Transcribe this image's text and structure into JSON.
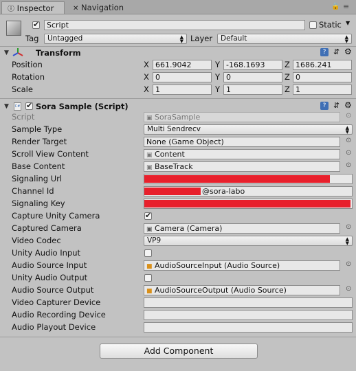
{
  "tabs": [
    {
      "label": "Inspector",
      "active": true
    },
    {
      "label": "Navigation",
      "active": false
    }
  ],
  "object": {
    "name": "Script",
    "static_label": "Static",
    "tag_label": "Tag",
    "tag_value": "Untagged",
    "layer_label": "Layer",
    "layer_value": "Default"
  },
  "transform": {
    "title": "Transform",
    "rows": [
      {
        "label": "Position",
        "x": "661.9042",
        "y": "-168.1693",
        "z": "1686.241"
      },
      {
        "label": "Rotation",
        "x": "0",
        "y": "0",
        "z": "0"
      },
      {
        "label": "Scale",
        "x": "1",
        "y": "1",
        "z": "1"
      }
    ],
    "axis": {
      "x": "X",
      "y": "Y",
      "z": "Z"
    }
  },
  "component": {
    "title": "Sora Sample (Script)",
    "script_label": "Script",
    "script_value": "SoraSample",
    "sample_type": {
      "label": "Sample Type",
      "value": "Multi Sendrecv"
    },
    "render_target": {
      "label": "Render Target",
      "value": "None (Game Object)"
    },
    "scroll_view_content": {
      "label": "Scroll View Content",
      "value": "Content"
    },
    "base_content": {
      "label": "Base Content",
      "value": "BaseTrack"
    },
    "signaling_url": {
      "label": "Signaling Url"
    },
    "channel_id": {
      "label": "Channel Id",
      "value": "@sora-labo"
    },
    "signaling_key": {
      "label": "Signaling Key"
    },
    "capture_unity_camera": {
      "label": "Capture Unity Camera",
      "checked": true
    },
    "captured_camera": {
      "label": "Captured Camera",
      "value": "Camera (Camera)"
    },
    "video_codec": {
      "label": "Video Codec",
      "value": "VP9"
    },
    "unity_audio_input": {
      "label": "Unity Audio Input",
      "checked": false
    },
    "audio_source_input": {
      "label": "Audio Source Input",
      "value": "AudioSourceInput (Audio Source)"
    },
    "unity_audio_output": {
      "label": "Unity Audio Output",
      "checked": false
    },
    "audio_source_output": {
      "label": "Audio Source Output",
      "value": "AudioSourceOutput (Audio Source)"
    },
    "video_capturer_device": {
      "label": "Video Capturer Device",
      "value": ""
    },
    "audio_recording_device": {
      "label": "Audio Recording Device",
      "value": ""
    },
    "audio_playout_device": {
      "label": "Audio Playout Device",
      "value": ""
    }
  },
  "add_component": "Add Component",
  "colors": {
    "redaction": "#e8202c",
    "background": "#c2c2c2"
  }
}
